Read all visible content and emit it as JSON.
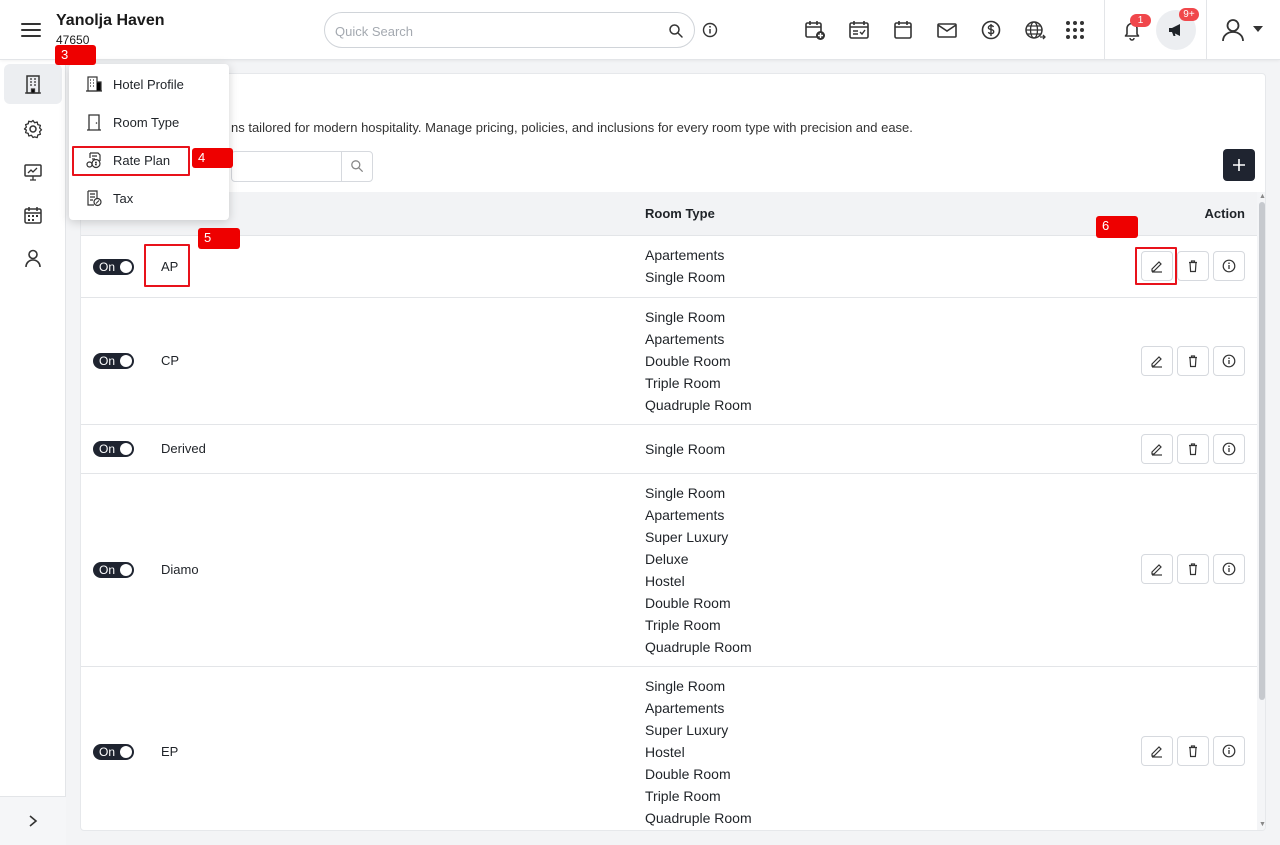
{
  "header": {
    "hotel_name": "Yanolja Haven",
    "hotel_id": "47650",
    "search_placeholder": "Quick Search",
    "notification_count": "1",
    "announcement_count": "9+"
  },
  "menu": {
    "items": [
      {
        "label": "Hotel Profile"
      },
      {
        "label": "Room Type"
      },
      {
        "label": "Rate Plan"
      },
      {
        "label": "Tax"
      }
    ]
  },
  "page": {
    "description": "ns tailored for modern hospitality. Manage pricing, policies, and inclusions for every room type with precision and ease."
  },
  "table": {
    "col_room_type": "Room Type",
    "col_action": "Action",
    "toggle_label": "On",
    "rows": [
      {
        "name": "AP",
        "rooms": [
          "Apartements",
          "Single Room"
        ]
      },
      {
        "name": "CP",
        "rooms": [
          "Single Room",
          "Apartements",
          "Double Room",
          "Triple Room",
          "Quadruple Room"
        ]
      },
      {
        "name": "Derived",
        "rooms": [
          "Single Room"
        ]
      },
      {
        "name": "Diamo",
        "rooms": [
          "Single Room",
          "Apartements",
          "Super Luxury",
          "Deluxe",
          "Hostel",
          "Double Room",
          "Triple Room",
          "Quadruple Room"
        ]
      },
      {
        "name": "EP",
        "rooms": [
          "Single Room",
          "Apartements",
          "Super Luxury",
          "Hostel",
          "Double Room",
          "Triple Room",
          "Quadruple Room"
        ]
      }
    ]
  },
  "annotations": [
    "3",
    "4",
    "5",
    "6"
  ],
  "colors": {
    "accent_dark": "#1f2430",
    "annotation_red": "#ee0000",
    "badge_red": "#f0474b"
  }
}
